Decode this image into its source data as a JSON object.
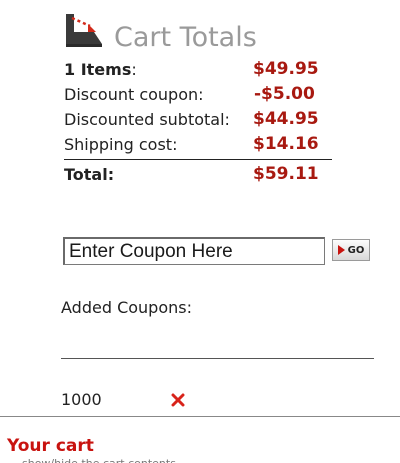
{
  "header": {
    "icon": "shopping-cart-icon",
    "title": "Cart Totals"
  },
  "totals": {
    "items_count": "1 Items",
    "items_suffix": ":",
    "items_value": "$49.95",
    "discount_label": "Discount coupon:",
    "discount_value": "-$5.00",
    "discounted_subtotal_label": "Discounted subtotal:",
    "discounted_subtotal_value": "$44.95",
    "shipping_label": "Shipping cost:",
    "shipping_value": "$14.16",
    "total_label": "Total:",
    "total_value": "$59.11"
  },
  "coupon": {
    "input_placeholder": "Enter Coupon Here",
    "go_label": "GO"
  },
  "added_coupons": {
    "heading": "Added Coupons:",
    "items": [
      {
        "code": "1000"
      }
    ],
    "remove_icon": "remove-x-icon"
  },
  "footer": {
    "your_cart_label": "Your cart",
    "truncated_text": "show/hide the cart contents"
  },
  "colors": {
    "accent_red": "#a81910",
    "title_gray": "#9a9a9a"
  }
}
